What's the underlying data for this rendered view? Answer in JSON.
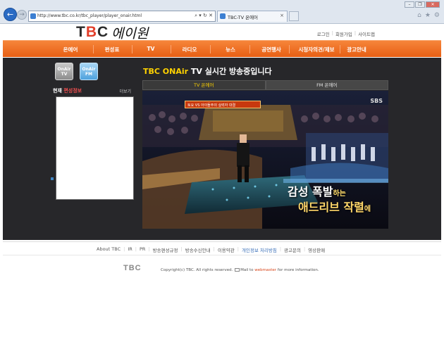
{
  "browser": {
    "url": "http://www.tbc.co.kr/tbc_player/player_onair.html",
    "tab_title": "TBC-TV 온에어",
    "tab_close": "×",
    "search_tools": "⌕ ▾ ↻ ✕",
    "window_buttons": [
      "–",
      "❐",
      "✕"
    ],
    "icons": [
      "home-icon",
      "star-icon",
      "gear-icon"
    ]
  },
  "header": {
    "logo_t": "T",
    "logo_b": "B",
    "logo_c": "C",
    "logo_script": "에이원",
    "links": [
      "로그인",
      "회원가입",
      "사이트맵"
    ]
  },
  "nav": {
    "items": [
      "온에어",
      "편성표",
      "TV",
      "라디오",
      "뉴스",
      "공연행사",
      "시청자의견/제보",
      "광고안내"
    ]
  },
  "player": {
    "btn_tv": "OnAir TV",
    "btn_fm": "OnAir FM",
    "schedule_prefix": "현재",
    "schedule_highlight": "편성정보",
    "schedule_more": "더보기",
    "title_accent": "TBC ONAir",
    "title_rest": "TV 실시간 방송중입니다",
    "channel_tabs": [
      "TV 온에어",
      "FM 온에어"
    ],
    "video_banner": "토요 VS 아이돌주의 실력자 대결",
    "video_logo": "SBS",
    "caption_line1_a": "감성 폭발",
    "caption_line1_b": "하는",
    "caption_line2_a": "애드리브 작렬",
    "caption_line2_b": "에"
  },
  "footer": {
    "links": [
      "About TBC",
      "IR",
      "PR",
      "방송편성규정",
      "방송수신안내",
      "이용약관",
      "개인정보 처리방침",
      "광고문의",
      "영상판매"
    ],
    "logo": "TBC",
    "copyright_a": "Copyright(c) TBC. All rights reserved.",
    "mail_text": "Mail to",
    "webmaster": "webmaster",
    "copyright_b": "for more information."
  }
}
